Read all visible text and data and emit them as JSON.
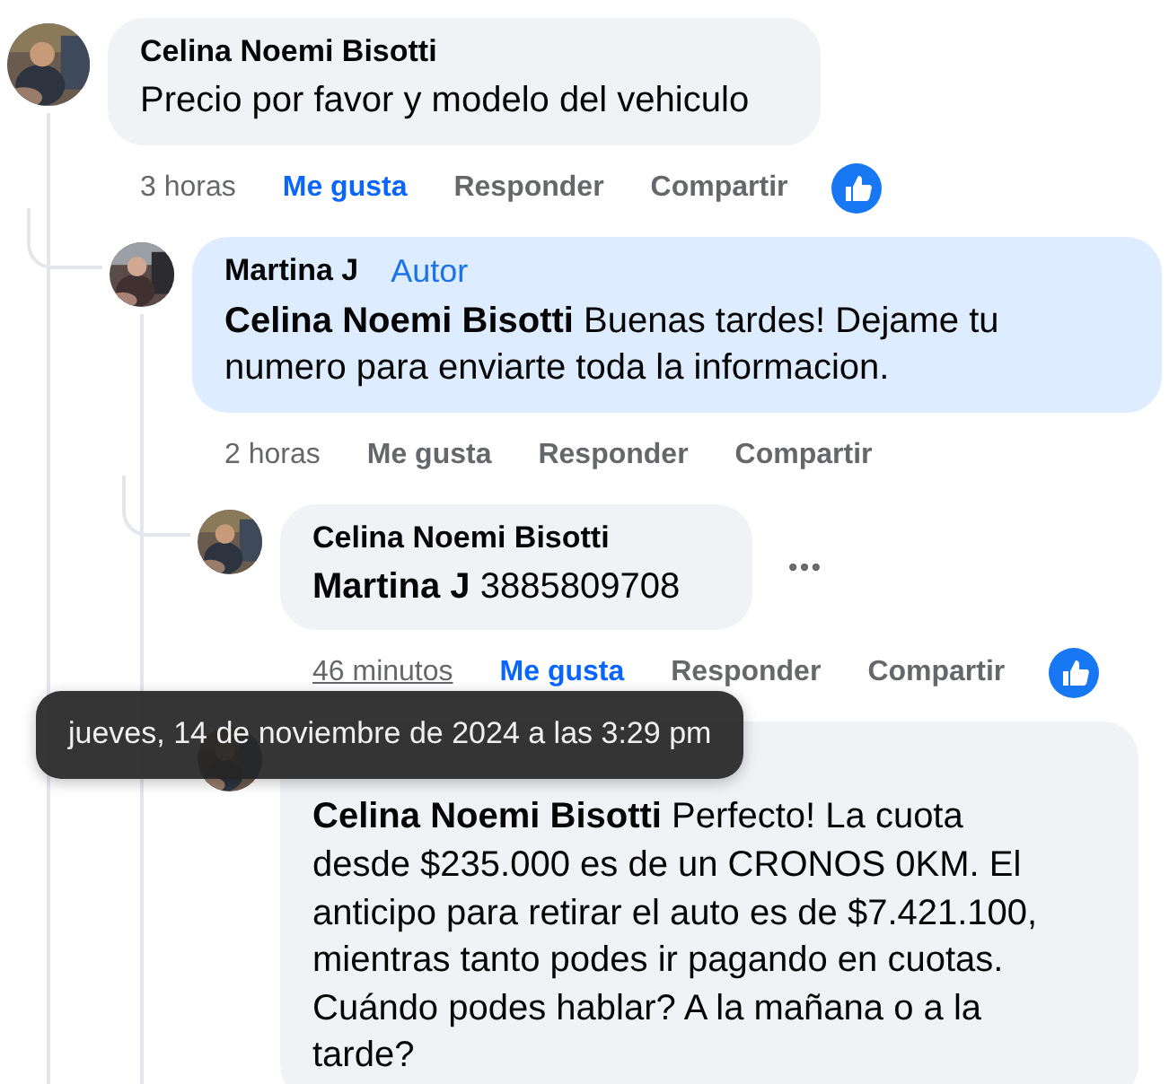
{
  "comments": [
    {
      "author": "Celina Noemi Bisotti",
      "highlighted": false,
      "text": "Precio por favor y modelo del vehiculo",
      "menu_visible": false,
      "time": "3 horas",
      "time_hovered": false,
      "liked": true,
      "reaction": true,
      "actions": [
        "Me gusta",
        "Responder",
        "Compartir"
      ],
      "children": [
        {
          "author": "Martina J",
          "badge": "Autor",
          "highlighted": true,
          "text": "**Celina Noemi Bisotti** Buenas tardes! Dejame tu numero para enviarte toda la informacion.",
          "menu_visible": false,
          "time": "2 horas",
          "time_hovered": false,
          "liked": false,
          "reaction": false,
          "actions": [
            "Me gusta",
            "Responder",
            "Compartir"
          ],
          "children": [
            {
              "author": "Celina Noemi Bisotti",
              "highlighted": false,
              "text": "**Martina J** 3885809708",
              "menu_visible": true,
              "time": "46 minutos",
              "time_hovered": true,
              "liked": true,
              "reaction": true,
              "actions": [
                "Me gusta",
                "Responder",
                "Compartir"
              ]
            },
            {
              "highlighted": false,
              "text": "**Celina Noemi Bisotti** Perfecto! La cuota desde $235.000 es de un CRONOS 0KM. El anticipo para retirar el auto es de $7.421.100, mientras tanto podes ir pagando en cuotas. Cuándo podes hablar? A la mañana o a la tarde?"
            }
          ]
        }
      ]
    }
  ],
  "tooltip": {
    "text": "jueves, 14 de noviembre de 2024 a las 3:29 pm"
  }
}
